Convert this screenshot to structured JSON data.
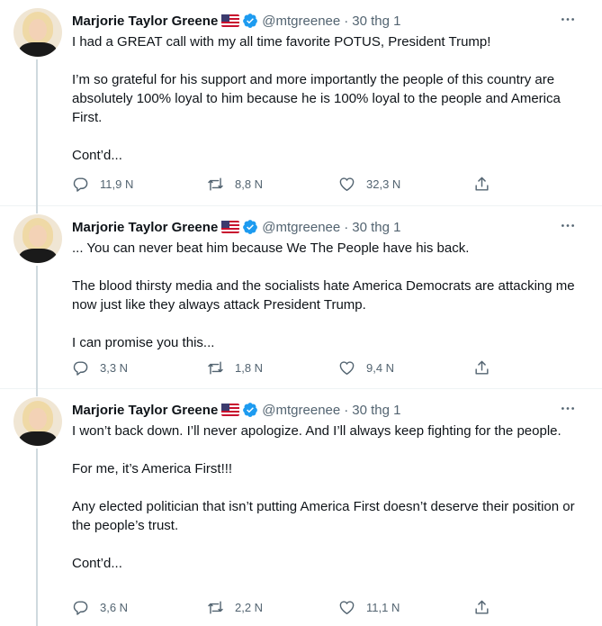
{
  "colors": {
    "accent": "#1d9bf0",
    "text": "#0f1419",
    "muted": "#536471",
    "divider": "#eff3f4"
  },
  "tweets": [
    {
      "author": "Marjorie Taylor Greene",
      "flag": "🇺🇸",
      "handle": "@mtgreenee",
      "time": "30 thg 1",
      "paragraphs": [
        "I had a GREAT call with my all time favorite POTUS, President Trump!",
        "I’m so grateful for his support and more importantly the people of this country are absolutely 100% loyal to him because he is 100% loyal to the people and America First.",
        "Cont’d..."
      ],
      "replies": "11,9 N",
      "retweets": "8,8 N",
      "likes": "32,3 N"
    },
    {
      "author": "Marjorie Taylor Greene",
      "flag": "🇺🇸",
      "handle": "@mtgreenee",
      "time": "30 thg 1",
      "paragraphs": [
        "... You can never beat him because We The People have his back.",
        "The blood thirsty media and the socialists hate America Democrats are attacking me now just like they always attack President Trump.",
        "I can promise you this..."
      ],
      "replies": "3,3 N",
      "retweets": "1,8 N",
      "likes": "9,4 N"
    },
    {
      "author": "Marjorie Taylor Greene",
      "flag": "🇺🇸",
      "handle": "@mtgreenee",
      "time": "30 thg 1",
      "paragraphs": [
        "I won’t back down. I’ll never apologize. And I’ll always keep fighting for the people.",
        "For me, it’s America First!!!",
        "Any elected politician that isn’t putting America First doesn’t deserve their position or the people’s trust.",
        "Cont’d..."
      ],
      "replies": "3,6 N",
      "retweets": "2,2 N",
      "likes": "11,1 N"
    }
  ],
  "icons": {
    "verified": "verified-badge-icon",
    "more": "more-options-icon",
    "reply": "reply-icon",
    "retweet": "retweet-icon",
    "like": "heart-icon",
    "share": "share-icon"
  }
}
